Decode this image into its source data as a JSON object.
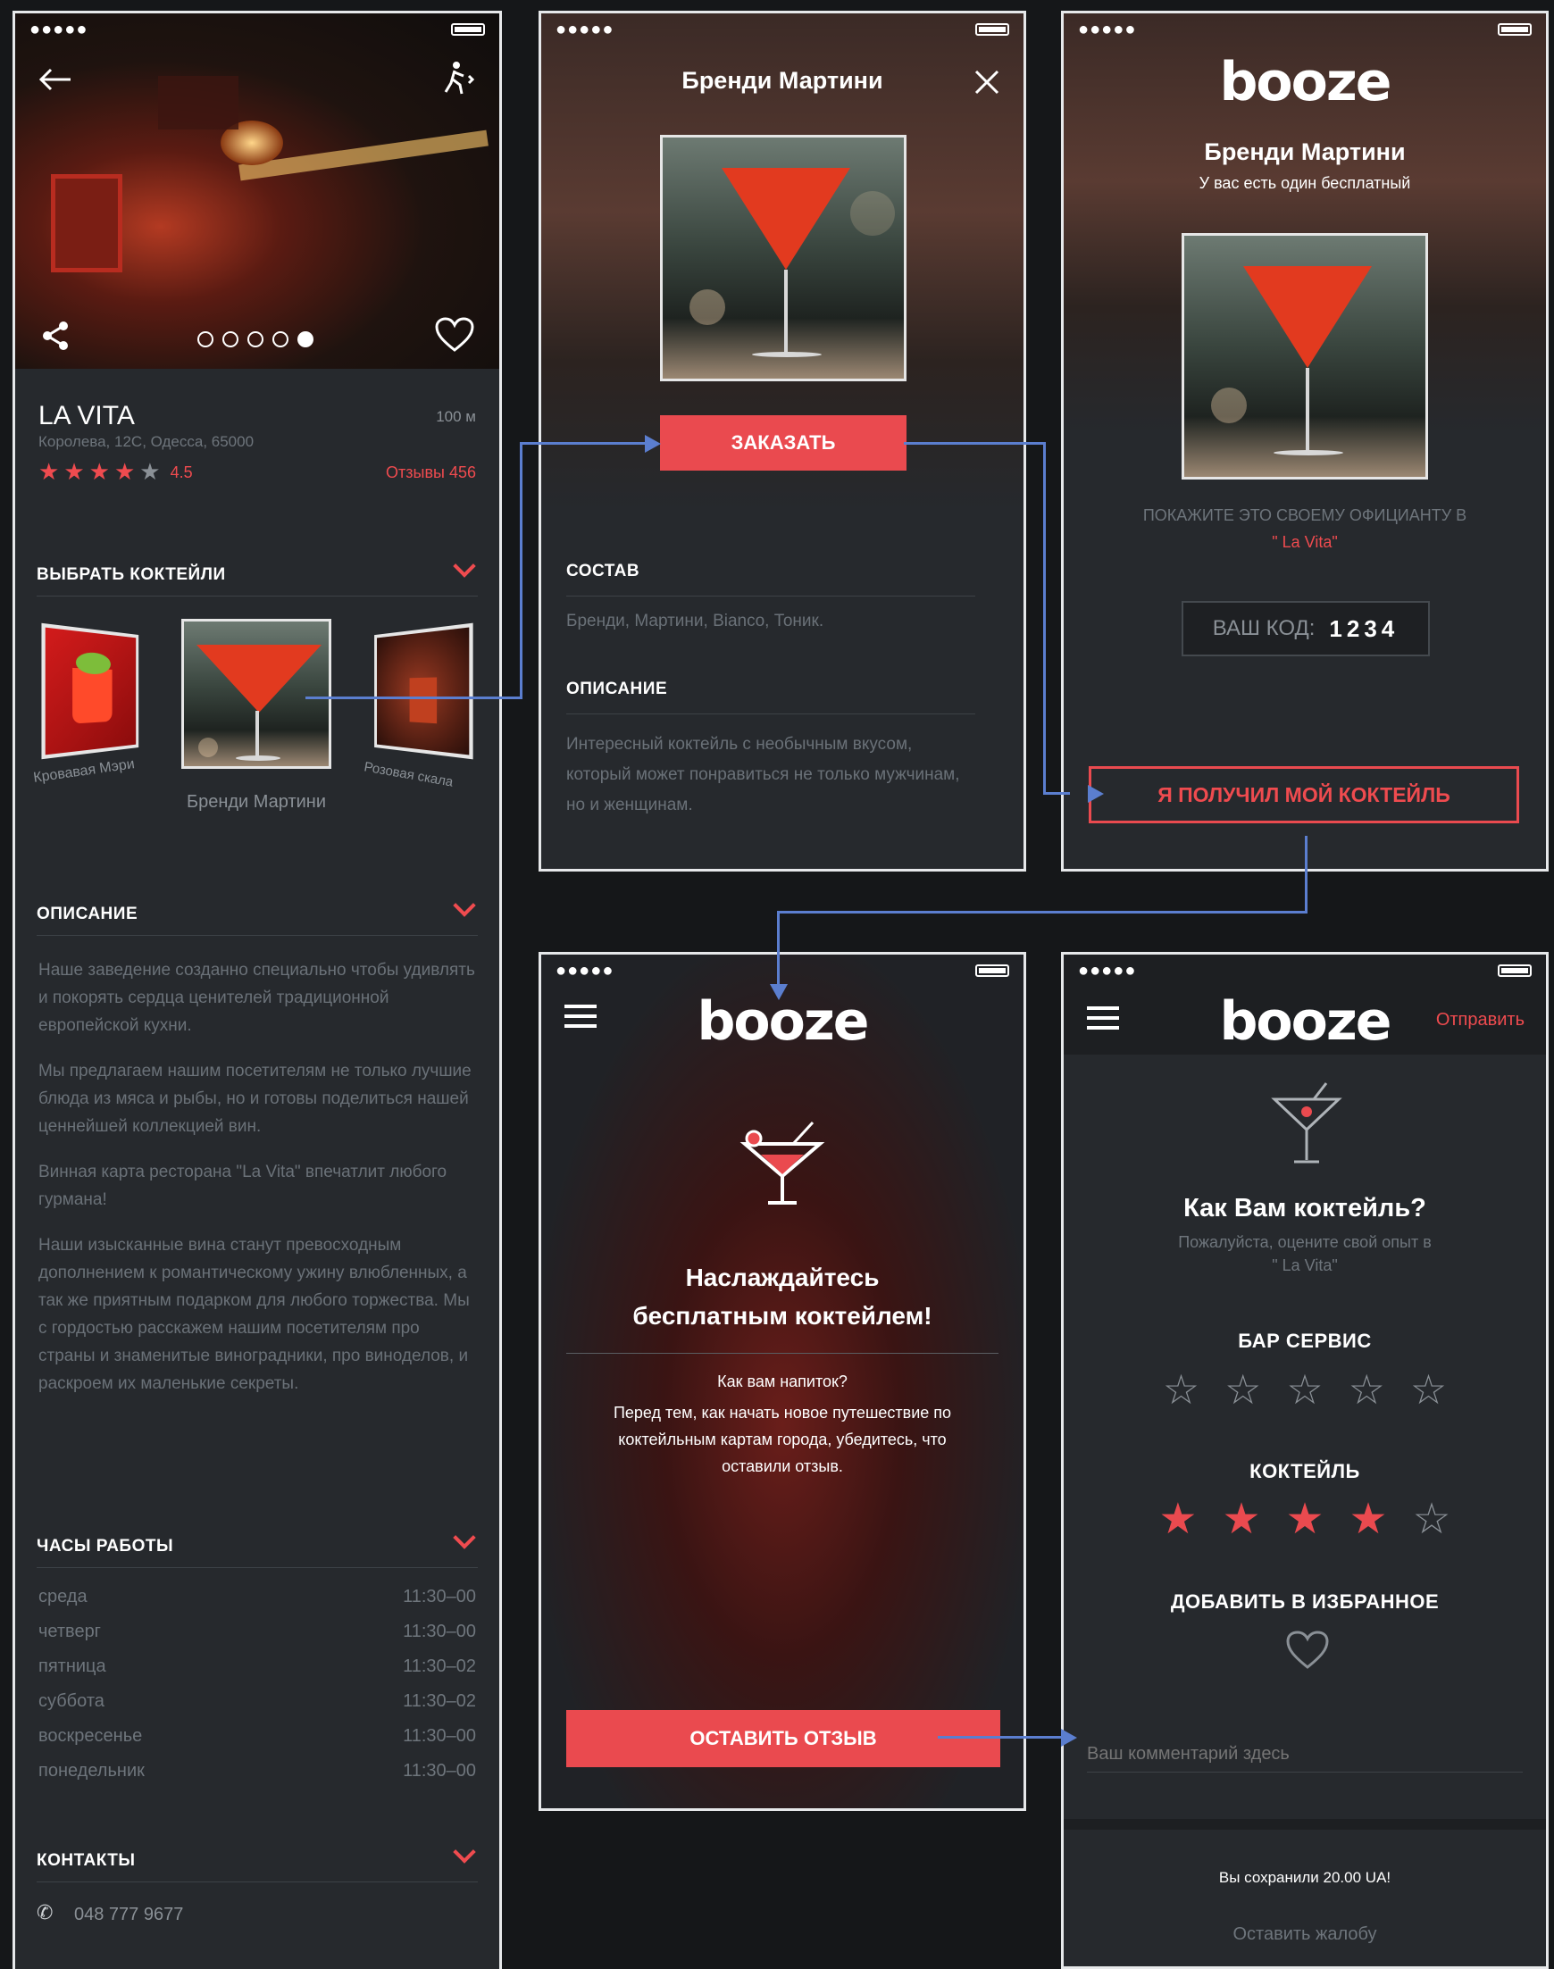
{
  "status": {
    "signal": "●●●●●",
    "wifi": "wifi"
  },
  "screen1": {
    "venue_name": "LA VITA",
    "address": "Королева, 12С, Одесса, 65000",
    "distance": "100 м",
    "rating": "4.5",
    "rating_stars": 4.5,
    "reviews": "Отзывы 456",
    "pager_dots": 5,
    "pager_active": 5,
    "select_title": "ВЫБРАТЬ КОКТЕЙЛИ",
    "cocktails": [
      {
        "label": "Кровавая Мэри"
      },
      {
        "label": "Бренди Мартини"
      },
      {
        "label": "Розовая скала"
      }
    ],
    "desc_title": "ОПИСАНИЕ",
    "desc_paragraphs": [
      "Наше заведение созданно специально чтобы удивлять и покорять сердца ценителей традиционной европейской кухни.",
      "Мы предлагаем нашим посетителям не только лучшие блюда из мяса и рыбы, но и готовы поделиться нашей ценнейшей коллекцией вин.",
      "Винная карта ресторана \"La Vita\" впечатлит любого гурмана!",
      "Наши изысканные вина станут превосходным дополнением к романтическому ужину влюбленных, а так же приятным подарком для любого торжества. Мы с гордостью расскажем нашим посетителям про страны и знаменитые виноградники, про виноделов, и раскроем их маленькие секреты."
    ],
    "hours_title": "ЧАСЫ РАБОТЫ",
    "hours": [
      {
        "day": "среда",
        "time": "11:30–00"
      },
      {
        "day": "четверг",
        "time": "11:30–00"
      },
      {
        "day": "пятница",
        "time": "11:30–02"
      },
      {
        "day": "суббота",
        "time": "11:30–02"
      },
      {
        "day": "воскресенье",
        "time": "11:30–00"
      },
      {
        "day": "понедельник",
        "time": "11:30–00"
      }
    ],
    "contacts_title": "КОНТАКТЫ",
    "phone": "048 777 9677"
  },
  "screen2": {
    "title": "Бренди Мартини",
    "order_button": "ЗАКАЗАТЬ",
    "composition_title": "СОСТАВ",
    "composition": "Бренди, Мартини, Bianco, Тоник.",
    "desc_title": "ОПИСАНИЕ",
    "desc": "Интересный коктейль с необычным вкусом, который может понравиться не только мужчинам, но и женщинам."
  },
  "screen3": {
    "logo": "booze",
    "title": "Бренди Мартини",
    "subtitle": "У вас есть один бесплатный",
    "instruction": "ПОКАЖИТЕ ЭТО СВОЕМУ ОФИЦИАНТУ В",
    "venue": "\" La Vita\"",
    "code_label": "ВАШ КОД:",
    "code_value": "1234",
    "received_button": "Я ПОЛУЧИЛ МОЙ КОКТЕЙЛЬ"
  },
  "screen4": {
    "logo": "booze",
    "headline": "Наслаждайтесь бесплатным коктейлем!",
    "question": "Как вам напиток?",
    "message": "Перед тем, как начать новое путешествие по коктейльным картам города, убедитесь, что оставили отзыв.",
    "review_button": "ОСТАВИТЬ ОТЗЫВ"
  },
  "screen5": {
    "logo": "booze",
    "send": "Отправить",
    "title": "Как Вам коктейль?",
    "subtitle": "Пожалуйста, оцените свой опыт в",
    "venue": "\" La Vita\"",
    "bar_service_title": "БАР СЕРВИС",
    "bar_service_rating": 0,
    "cocktail_title": "КОКТЕЙЛЬ",
    "cocktail_rating": 4,
    "favorite_title": "ДОБАВИТЬ В ИЗБРАННОЕ",
    "comment_placeholder": "Ваш комментарий здесь",
    "saved": "Вы сохранили 20.00 UA!",
    "complaint": "Оставить жалобу"
  },
  "colors": {
    "accent": "#ea4a4f",
    "connector": "#5b7ecf",
    "panel": "#26292d"
  }
}
